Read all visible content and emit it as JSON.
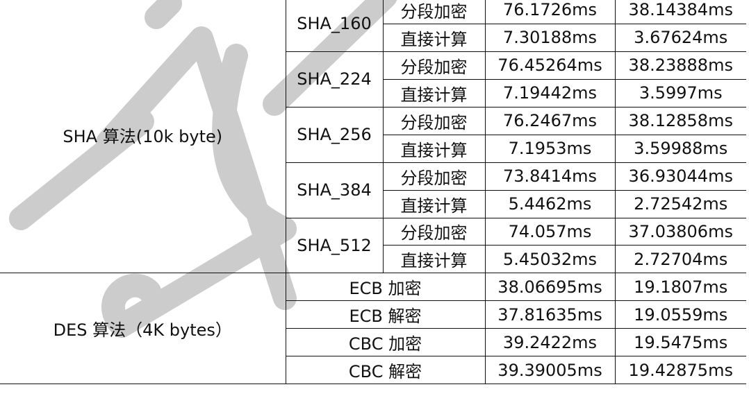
{
  "sha": {
    "group_label": "SHA 算法(10k byte)",
    "algorithms": [
      {
        "name": "SHA_160",
        "rows": [
          {
            "method": "分段加密",
            "t1": "76.1726ms",
            "t2": "38.14384ms"
          },
          {
            "method": "直接计算",
            "t1": "7.30188ms",
            "t2": "3.67624ms"
          }
        ]
      },
      {
        "name": "SHA_224",
        "rows": [
          {
            "method": "分段加密",
            "t1": "76.45264ms",
            "t2": "38.23888ms"
          },
          {
            "method": "直接计算",
            "t1": "7.19442ms",
            "t2": "3.5997ms"
          }
        ]
      },
      {
        "name": "SHA_256",
        "rows": [
          {
            "method": "分段加密",
            "t1": "76.2467ms",
            "t2": "38.12858ms"
          },
          {
            "method": "直接计算",
            "t1": "7.1953ms",
            "t2": "3.59988ms"
          }
        ]
      },
      {
        "name": "SHA_384",
        "rows": [
          {
            "method": "分段加密",
            "t1": "73.8414ms",
            "t2": "36.93044ms"
          },
          {
            "method": "直接计算",
            "t1": "5.4462ms",
            "t2": "2.72542ms"
          }
        ]
      },
      {
        "name": "SHA_512",
        "rows": [
          {
            "method": "分段加密",
            "t1": "74.057ms",
            "t2": "37.03806ms"
          },
          {
            "method": "直接计算",
            "t1": "5.45032ms",
            "t2": "2.72704ms"
          }
        ]
      }
    ]
  },
  "des": {
    "group_label": "DES 算法（4K bytes）",
    "rows": [
      {
        "mode": "ECB 加密",
        "t1": "38.06695ms",
        "t2": "19.1807ms"
      },
      {
        "mode": "ECB 解密",
        "t1": "37.81635ms",
        "t2": "19.0559ms"
      },
      {
        "mode": "CBC 加密",
        "t1": "39.2422ms",
        "t2": "19.5475ms"
      },
      {
        "mode": "CBC 解密",
        "t1": "39.39005ms",
        "t2": "19.42875ms"
      }
    ]
  },
  "watermark": {
    "text": "yj",
    "color": "#cccccc"
  }
}
